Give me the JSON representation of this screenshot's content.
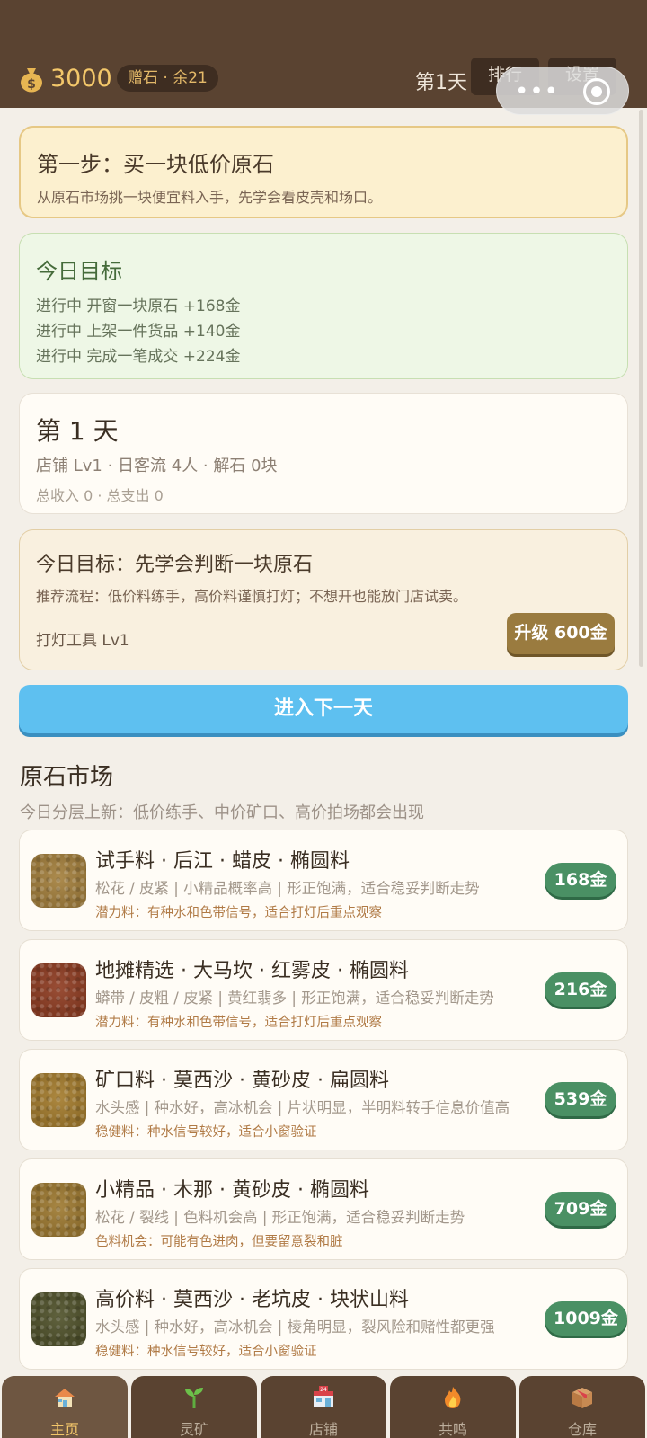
{
  "header": {
    "coins": "3000",
    "gift_pill": "赠石 · 余21",
    "day": "第1天",
    "rank_button": "排行",
    "settings_button": "设置"
  },
  "step_card": {
    "title": "第一步：买一块低价原石",
    "desc": "从原石市场挑一块便宜料入手，先学会看皮壳和场口。"
  },
  "daily_goals": {
    "title": "今日目标",
    "items": [
      "进行中 开窗一块原石  +168金",
      "进行中 上架一件货品  +140金",
      "进行中 完成一笔成交  +224金"
    ]
  },
  "day_card": {
    "title": "第 1 天",
    "stats": "店铺 Lv1  ·  日客流 4人  ·  解石 0块",
    "finance": "总收入 0  ·  总支出 0"
  },
  "tool_card": {
    "title": "今日目标：先学会判断一块原石",
    "desc": "推荐流程：低价料练手，高价料谨慎打灯；不想开也能放门店试卖。",
    "tool_level": "打灯工具 Lv1",
    "upgrade_button": "升级 600金"
  },
  "next_day_button": "进入下一天",
  "market": {
    "title": "原石市场",
    "subtitle": "今日分层上新：低价练手、中价矿口、高价拍场都会出现",
    "items": [
      {
        "name": "试手料  ·  后江  ·  蜡皮  ·  椭圆料",
        "traits": "松花 / 皮紧 | 小精品概率高 | 形正饱满，适合稳妥判断走势",
        "note": "潜力料：有种水和色带信号，适合打灯后重点观察",
        "price": "168金",
        "color": "#a37e3a"
      },
      {
        "name": "地摊精选  ·  大马坎  ·  红雾皮  ·  椭圆料",
        "traits": "蟒带 / 皮粗 / 皮紧 | 黄红翡多 | 形正饱满，适合稳妥判断走势",
        "note": "潜力料：有种水和色带信号，适合打灯后重点观察",
        "price": "216金",
        "color": "#8e3a1f"
      },
      {
        "name": "矿口料  ·  莫西沙  ·  黄砂皮  ·  扁圆料",
        "traits": "水头感 | 种水好，高冰机会 | 片状明显，半明料转手信息价值高",
        "note": "稳健料：种水信号较好，适合小窗验证",
        "price": "539金",
        "color": "#a37a2a"
      },
      {
        "name": "小精品  ·  木那  ·  黄砂皮  ·  椭圆料",
        "traits": "松花 / 裂线 | 色料机会高 | 形正饱满，适合稳妥判断走势",
        "note": "色料机会：可能有色进肉，但要留意裂和脏",
        "price": "709金",
        "color": "#9d782e"
      },
      {
        "name": "高价料  ·  莫西沙  ·  老坑皮  ·  块状山料",
        "traits": "水头感 | 种水好，高冰机会 | 棱角明显，裂风险和赌性都更强",
        "note": "稳健料：种水信号较好，适合小窗验证",
        "price": "1009金",
        "color": "#4e5028"
      }
    ]
  },
  "tabs": [
    {
      "label": "主页",
      "icon": "home-icon",
      "active": true
    },
    {
      "label": "灵矿",
      "icon": "sprout-icon",
      "active": false
    },
    {
      "label": "店铺",
      "icon": "shop-icon",
      "active": false
    },
    {
      "label": "共鸣",
      "icon": "fire-icon",
      "active": false
    },
    {
      "label": "仓库",
      "icon": "box-icon",
      "active": false
    }
  ]
}
